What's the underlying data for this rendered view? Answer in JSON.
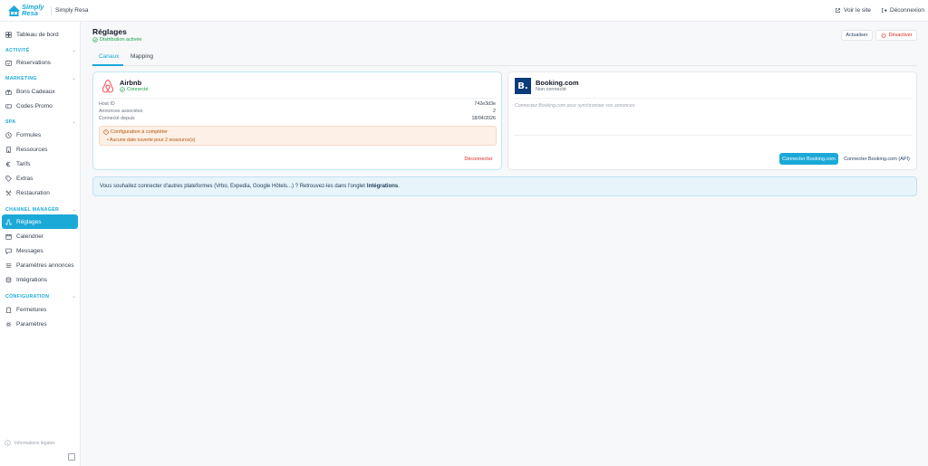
{
  "app": {
    "brand_line1": "Simply",
    "brand_line2": "Resa",
    "tenant": "Simply Resa",
    "view_site": "Voir le site",
    "logout": "Déconnexion"
  },
  "sidebar": {
    "dashboard": "Tableau de bord",
    "sections": {
      "activity": "ACTIVITÉ",
      "marketing": "MARKETING",
      "spa": "SPA",
      "channel_manager": "CHANNEL MANAGER",
      "configuration": "CONFIGURATION"
    },
    "items": {
      "reservations": "Réservations",
      "gift_cards": "Bons Cadeaux",
      "promo_codes": "Codes Promo",
      "formulas": "Formules",
      "resources": "Ressources",
      "rates": "Tarifs",
      "extras": "Extras",
      "restaurant": "Restauration",
      "settings_cm": "Réglages",
      "calendar": "Calendrier",
      "messages": "Messages",
      "listing_settings": "Paramètres annonces",
      "integrations": "Intégrations",
      "closures": "Fermetures",
      "settings": "Paramètres"
    },
    "legal": "Informations légales"
  },
  "page": {
    "title": "Réglages",
    "status": "Distribution activée",
    "refresh_label": "Actualiser",
    "disable_label": "Désactiver",
    "tabs": [
      "Canaux",
      "Mapping"
    ]
  },
  "airbnb": {
    "name": "Airbnb",
    "status": "Connecté",
    "rows": [
      {
        "label": "Host ID",
        "value": "742e3d3e"
      },
      {
        "label": "Annonces associées",
        "value": "2"
      },
      {
        "label": "Connecté depuis",
        "value": "18/04/2026"
      }
    ],
    "warning_title": "Configuration à compléter",
    "warning_item": "Aucune date ouverte pour 2 ressource(s)",
    "disconnect_label": "Déconnecter"
  },
  "booking": {
    "name": "Booking.com",
    "logo_letter": "B.",
    "status": "Non connecté",
    "description": "Connectez Booking.com pour synchroniser vos annonces.",
    "connect_label": "Connecter Booking.com",
    "connect_api_label": "Connecter Booking.com (API)"
  },
  "banner": {
    "text": "Vous souhaitez connecter d'autres plateformes (Vrbo, Expedia, Google Hôtels...) ? Retrouvez-les dans l'onglet",
    "link": "Intégrations",
    "suffix": "."
  },
  "colors": {
    "accent": "#1ba9d8",
    "success": "#16a34a",
    "danger": "#dc2626",
    "warning": "#b45309",
    "airbnb": "#ff5a5f",
    "booking": "#0c3b7c"
  }
}
